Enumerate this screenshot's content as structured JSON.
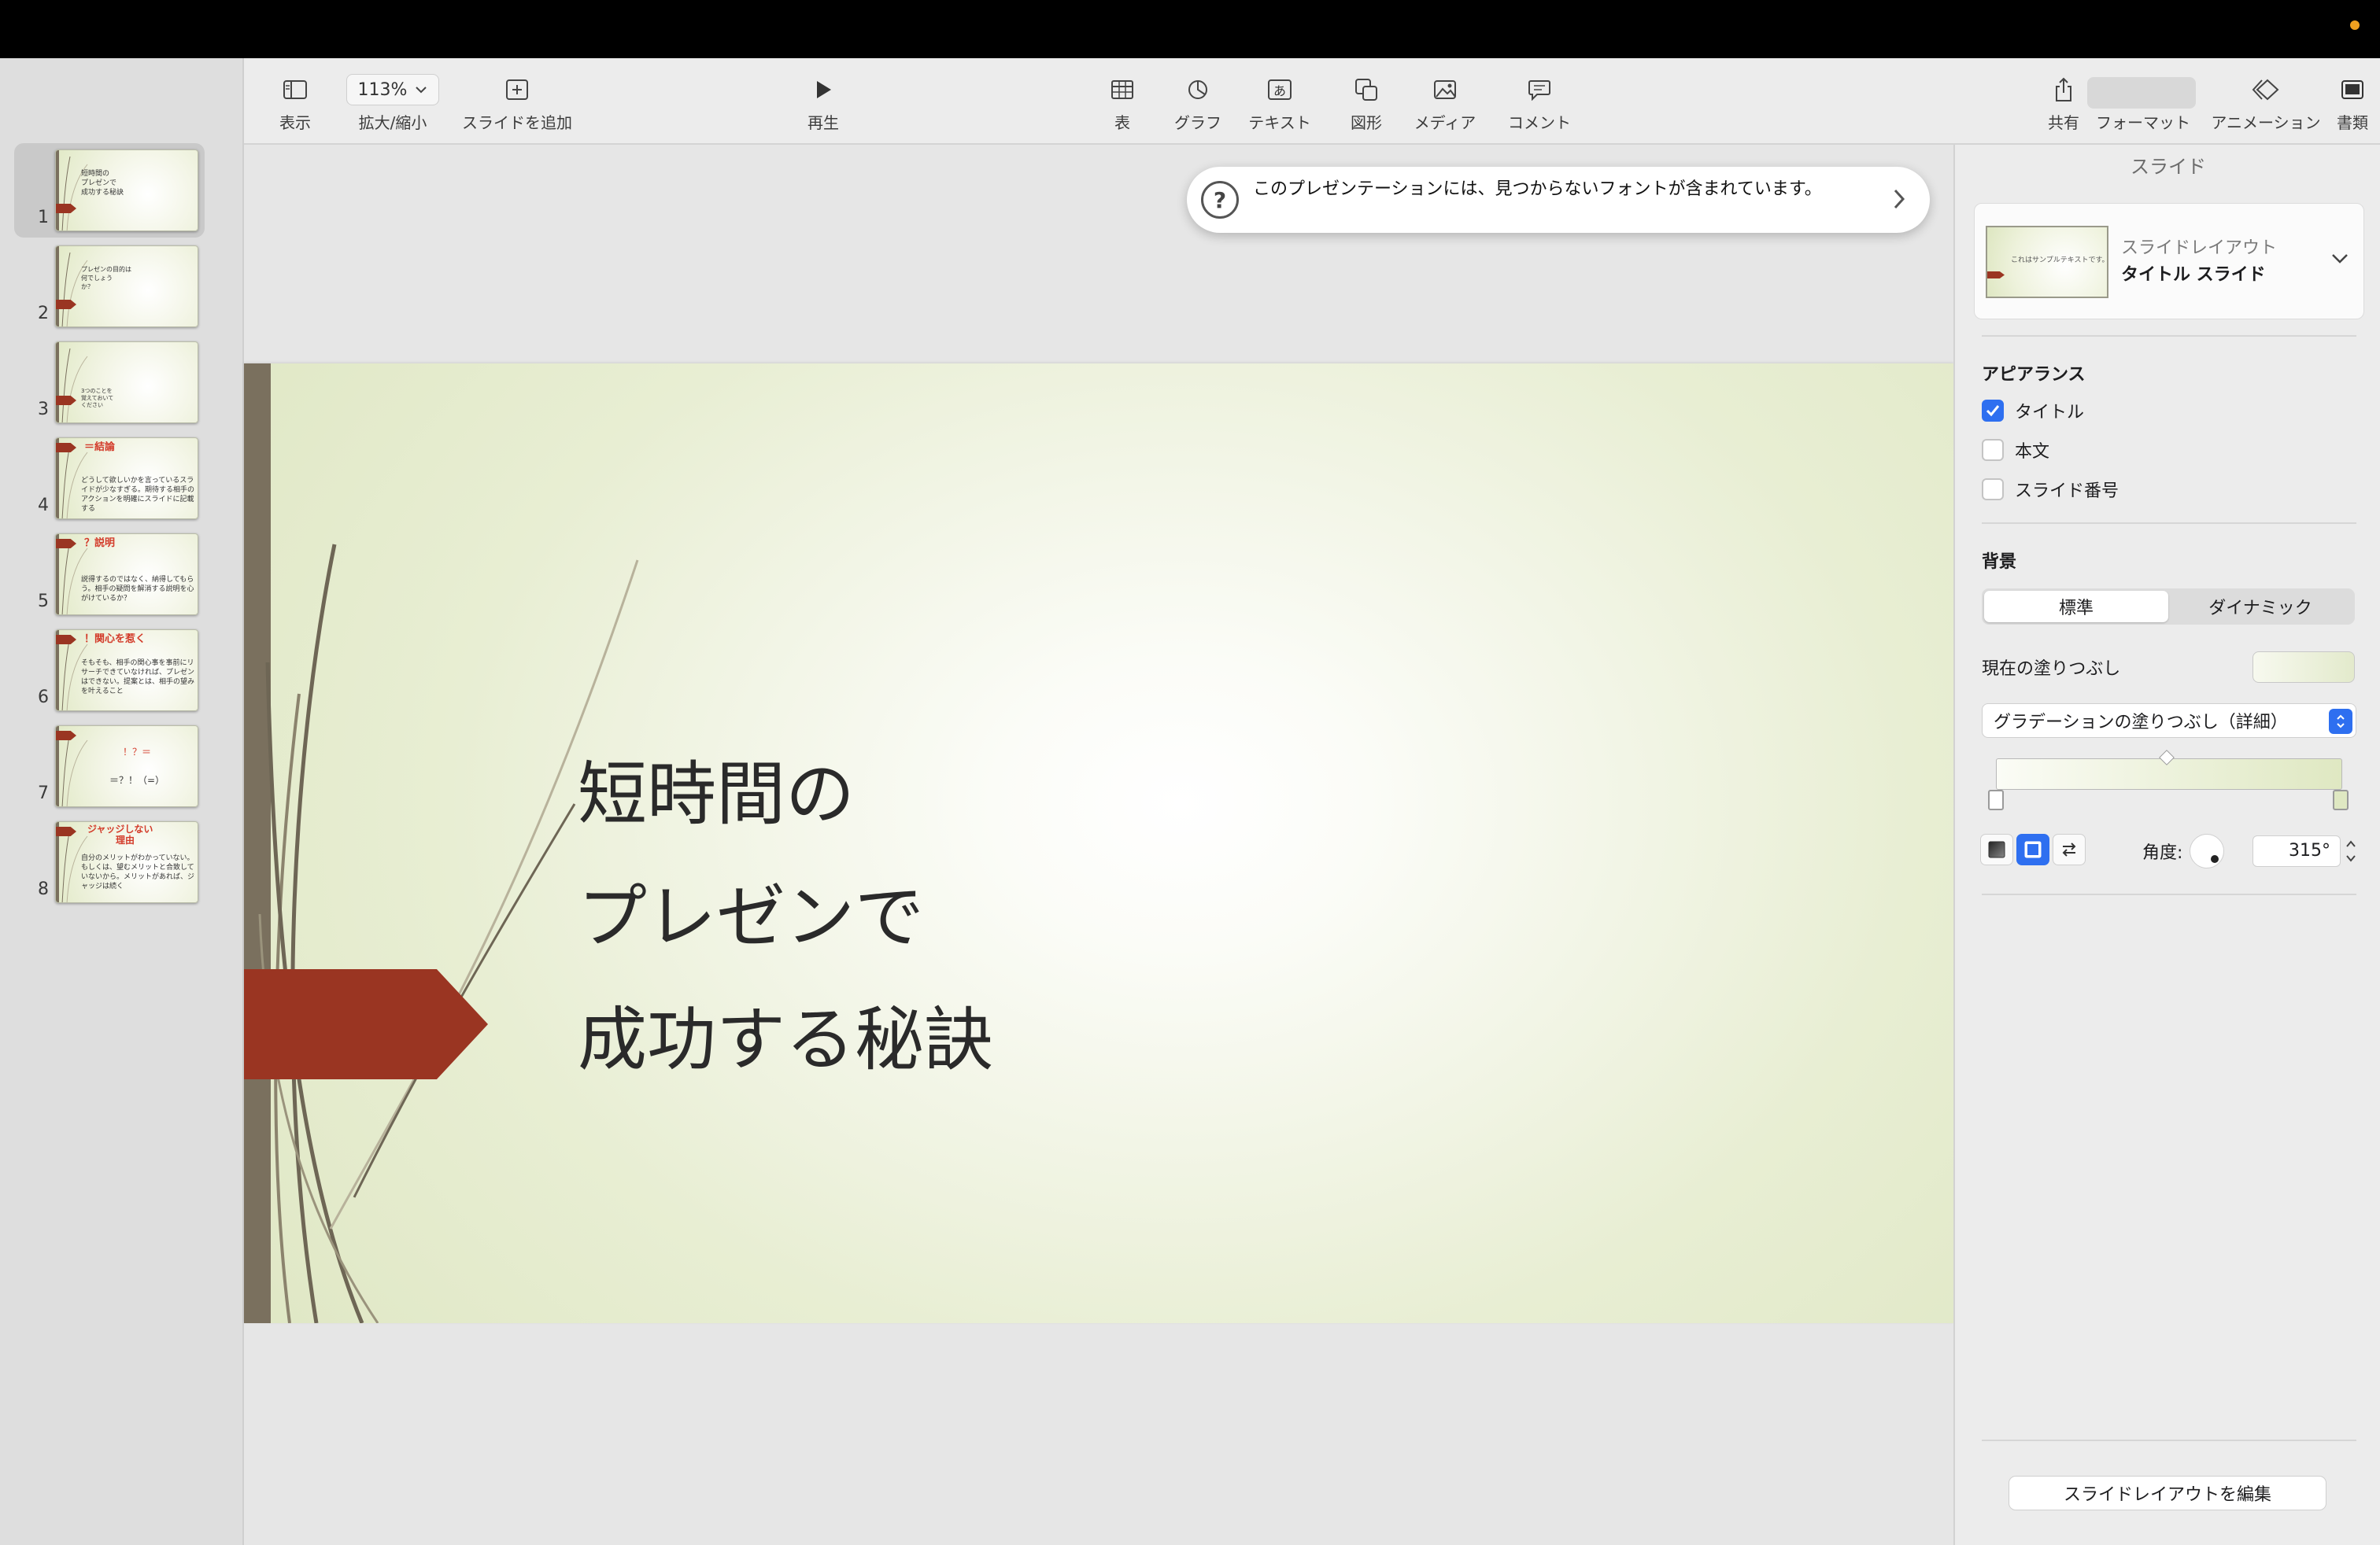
{
  "toolbar": {
    "view_label": "表示",
    "zoom_value": "113%",
    "zoom_label": "拡大/縮小",
    "add_slide_label": "スライドを追加",
    "play_label": "再生",
    "table_label": "表",
    "chart_label": "グラフ",
    "text_label": "テキスト",
    "shape_label": "図形",
    "media_label": "メディア",
    "comment_label": "コメント",
    "share_label": "共有",
    "format_label": "フォーマット",
    "animate_label": "アニメーション",
    "document_label": "書類",
    "text_icon_glyph": "あ"
  },
  "notice": {
    "icon": "?",
    "message": "このプレゼンテーションには、見つからないフォントが含まれています。"
  },
  "navigator": {
    "slides": [
      {
        "number": "1",
        "title": "",
        "text": "短時間の\nプレゼンで\n成功する秘訣"
      },
      {
        "number": "2",
        "title": "",
        "text": "プレゼンの目的は\n何でしょう\nか？"
      },
      {
        "number": "3",
        "title": "",
        "text": "3つのことを\n覚えておいて\nください"
      },
      {
        "number": "4",
        "title": "＝結論",
        "text": "どうして欲しいかを言っているスライドが少なすぎる。期待する相手のアクションを明確にスライドに記載する"
      },
      {
        "number": "5",
        "title": "？説明",
        "text": "説得するのではなく、納得してもらう。相手の疑問を解消する説明を心がけているか？"
      },
      {
        "number": "6",
        "title": "！関心を惹く",
        "text": "そもそも、相手の関心事を事前にリサーチできていなければ、プレゼンはできない。提案とは、相手の望みを叶えること"
      },
      {
        "number": "7",
        "title": "",
        "text": "",
        "line1": "！？＝",
        "line2": "＝？！（=）"
      },
      {
        "number": "8",
        "title": "ジャッジしない\n　　　理由",
        "text": "自分のメリットがわかっていない。もしくは、望むメリットと合致していないから。メリットがあれば、ジャッジは続く"
      }
    ]
  },
  "slide": {
    "title_lines": [
      "短時間の",
      "プレゼンで",
      "成功する秘訣"
    ]
  },
  "inspector": {
    "header": "スライド",
    "layout_caption": "スライドレイアウト",
    "layout_name": "タイトル スライド",
    "layout_preview_text": "これはサンプルテキストです。",
    "appearance_label": "アピアランス",
    "appearance": {
      "title": {
        "label": "タイトル",
        "checked": true
      },
      "body": {
        "label": "本文",
        "checked": false
      },
      "slide_number": {
        "label": "スライド番号",
        "checked": false
      }
    },
    "background_label": "背景",
    "bg_tabs": [
      "標準",
      "ダイナミック"
    ],
    "bg_tab_selected": "標準",
    "current_fill_label": "現在の塗りつぶし",
    "fill_type": "グラデーションの塗りつぶし（詳細）",
    "angle_label": "角度:",
    "angle_value": "315°",
    "edit_layout_button": "スライドレイアウトを編集"
  },
  "colors": {
    "accent_blue": "#2e6ff0",
    "flag_red": "#9a3522",
    "bar_brown": "#7a705e",
    "thumb_title_red": "#d33b2a"
  }
}
